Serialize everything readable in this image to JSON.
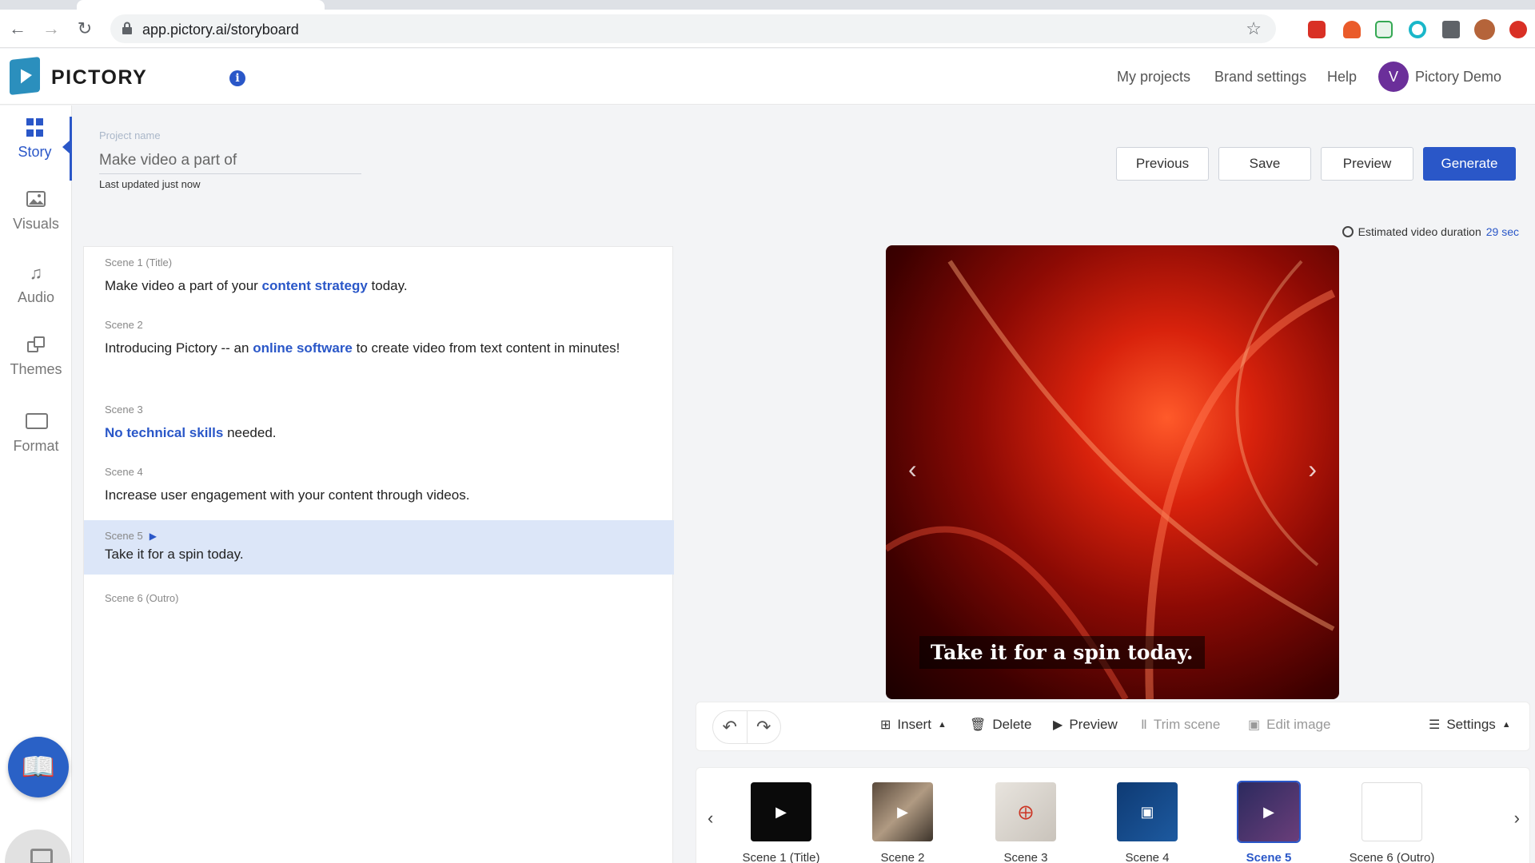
{
  "browser": {
    "url": "app.pictory.ai/storyboard"
  },
  "header": {
    "brand": "PICTORY",
    "links": [
      "My projects",
      "Brand settings",
      "Help"
    ],
    "avatar_letter": "V",
    "user_name": "Pictory Demo"
  },
  "sidebar": {
    "items": [
      {
        "label": "Story",
        "icon": "grid-icon"
      },
      {
        "label": "Visuals",
        "icon": "image-icon"
      },
      {
        "label": "Audio",
        "icon": "music-note-icon"
      },
      {
        "label": "Themes",
        "icon": "themes-icon"
      },
      {
        "label": "Format",
        "icon": "format-icon"
      }
    ]
  },
  "project": {
    "label": "Project name",
    "name": "Make video a part of",
    "last_updated": "Last updated just now"
  },
  "buttons": {
    "previous": "Previous",
    "save": "Save",
    "preview": "Preview",
    "generate": "Generate"
  },
  "duration": {
    "label": "Estimated video duration",
    "value": "29 sec"
  },
  "scenes": [
    {
      "label": "Scene 1 (Title)",
      "pre": "Make video a part of your ",
      "highlight": "content strategy",
      "post": " today."
    },
    {
      "label": "Scene 2",
      "pre": "Introducing Pictory -- an ",
      "highlight": "online software",
      "post": " to create video from text content in minutes!"
    },
    {
      "label": "Scene 3",
      "pre": "",
      "highlight": "No technical skills",
      "post": " needed."
    },
    {
      "label": "Scene 4",
      "pre": "Increase user engagement with  your content through videos.",
      "highlight": "",
      "post": ""
    },
    {
      "label": "Scene 5",
      "pre": "Take it for a spin today.",
      "highlight": "",
      "post": ""
    },
    {
      "label": "Scene 6 (Outro)",
      "pre": "",
      "highlight": "",
      "post": ""
    }
  ],
  "preview": {
    "caption": "Take it for a spin today."
  },
  "actions": {
    "insert": "Insert",
    "delete": "Delete",
    "preview": "Preview",
    "trim": "Trim scene",
    "edit_image": "Edit image",
    "settings": "Settings"
  },
  "timeline": {
    "labels": [
      "Scene 1 (Title)",
      "Scene 2",
      "Scene 3",
      "Scene 4",
      "Scene 5",
      "Scene 6 (Outro)"
    ]
  },
  "colors": {
    "accent": "#2a57c8",
    "active_scene_bg": "#dce6f8"
  }
}
